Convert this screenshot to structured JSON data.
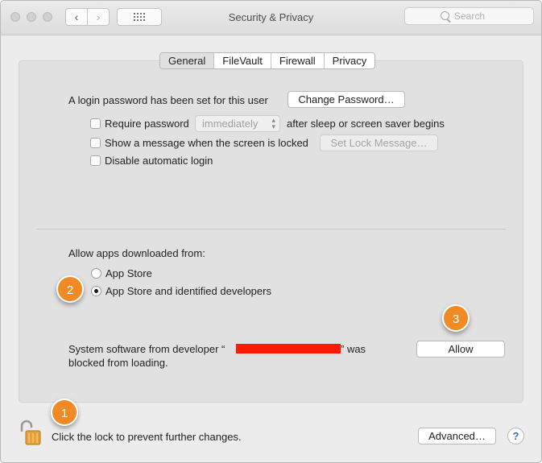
{
  "window": {
    "title": "Security & Privacy",
    "search_placeholder": "Search"
  },
  "tabs": [
    "General",
    "FileVault",
    "Firewall",
    "Privacy"
  ],
  "general": {
    "login_text": "A login password has been set for this user",
    "change_password_label": "Change Password…",
    "require_password_label": "Require password",
    "require_password_value": "immediately",
    "require_password_suffix": "after sleep or screen saver begins",
    "show_message_label": "Show a message when the screen is locked",
    "set_lock_message_label": "Set Lock Message…",
    "disable_auto_login_label": "Disable automatic login"
  },
  "downloads": {
    "heading": "Allow apps downloaded from:",
    "options": [
      "App Store",
      "App Store and identified developers"
    ],
    "selected_index": 1
  },
  "system_software": {
    "text_before": "System software from developer “",
    "text_after": "” was",
    "text_line2": "blocked from loading.",
    "allow_label": "Allow"
  },
  "footer": {
    "lock_text": "Click the lock to prevent further changes.",
    "advanced_label": "Advanced…",
    "help_label": "?"
  },
  "badges": [
    "1",
    "2",
    "3"
  ],
  "colors": {
    "badge": "#f08a24",
    "redaction": "#ff1a00",
    "lock": "#e8a13a"
  }
}
